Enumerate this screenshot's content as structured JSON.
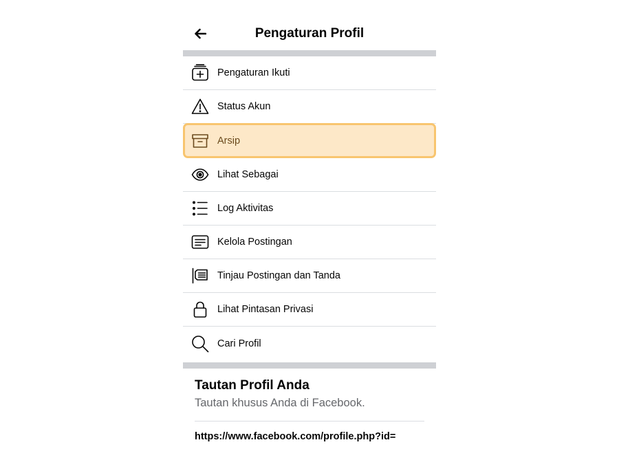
{
  "header": {
    "title": "Pengaturan Profil",
    "back_icon": "arrow-left-icon"
  },
  "menu": {
    "items": [
      {
        "label": "Pengaturan Ikuti",
        "icon": "follow-settings-icon"
      },
      {
        "label": "Status Akun",
        "icon": "warning-icon"
      },
      {
        "label": "Arsip",
        "icon": "archive-icon",
        "selected": true
      },
      {
        "label": "Lihat Sebagai",
        "icon": "eye-icon"
      },
      {
        "label": "Log Aktivitas",
        "icon": "list-icon"
      },
      {
        "label": "Kelola Postingan",
        "icon": "manage-posts-icon"
      },
      {
        "label": "Tinjau Postingan dan Tanda",
        "icon": "review-tags-icon"
      },
      {
        "label": "Lihat Pintasan Privasi",
        "icon": "lock-icon"
      },
      {
        "label": "Cari Profil",
        "icon": "search-icon"
      }
    ]
  },
  "profile_link": {
    "title": "Tautan Profil Anda",
    "subtitle": "Tautan khusus Anda di Facebook.",
    "url": "https://www.facebook.com/profile.php?id="
  },
  "colors": {
    "selected_bg": "#fde8c8",
    "selected_border": "#f8c56f",
    "divider": "#ced0d4"
  }
}
